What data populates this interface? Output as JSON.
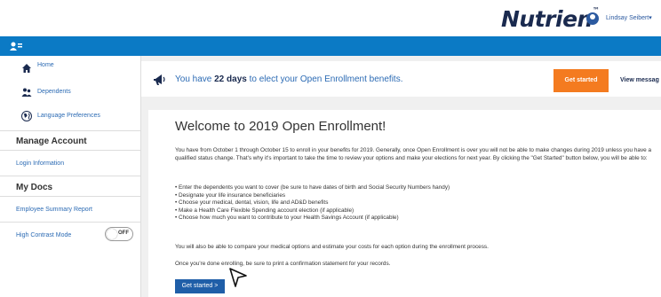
{
  "header": {
    "brand": "Nutrien",
    "brand_mark": "™",
    "user_name": "Lindsay Seibert",
    "user_chevron": "▾"
  },
  "sidebar": {
    "items": [
      {
        "label": "Home",
        "icon": "home-icon"
      },
      {
        "label": "Dependents",
        "icon": "people-icon"
      },
      {
        "label": "Language Preferences",
        "icon": "globe-icon"
      }
    ],
    "manage_account": {
      "heading": "Manage Account",
      "links": [
        "Login Information"
      ]
    },
    "my_docs": {
      "heading": "My Docs",
      "links": [
        "Employee Summary Report"
      ]
    },
    "high_contrast": {
      "label": "High Contrast Mode",
      "state": "OFF"
    }
  },
  "notice": {
    "prefix": "You have ",
    "days": "22 days",
    "suffix": " to elect your Open Enrollment benefits.",
    "button": "Get started",
    "view_messages": "View messag"
  },
  "card": {
    "title": "Welcome to 2019 Open Enrollment!",
    "intro": "You have from October 1 through October 15 to enroll in your benefits for 2019. Generally, once Open Enrollment is over you will not be able to make changes during 2019 unless you have a qualified status change. That's why it's important to take the time to review your options and make your elections for next year. By clicking the \"Get Started\" button below, you will be able to:",
    "bullets": [
      "• Enter the dependents you want to cover (be sure to have dates of birth and Social Security Numbers handy)",
      "• Designate your life insurance beneficiaries",
      "• Choose your medical, dental, vision, life and AD&D benefits",
      "• Make a Health Care Flexible Spending account election (if applicable)",
      "• Choose how much you want to contribute to your Health Savings Account (if applicable)"
    ],
    "compare": "You will also be able to compare your medical options and estimate your costs for each option during the enrollment process.",
    "print": "Once you're done enrolling, be sure to print a confirmation statement for your records.",
    "cta": "Get started >"
  },
  "colors": {
    "brand_blue": "#0b7ac5",
    "accent_orange": "#f47b20",
    "link_blue": "#2c6bb4",
    "cta_blue": "#1f5ea8"
  }
}
